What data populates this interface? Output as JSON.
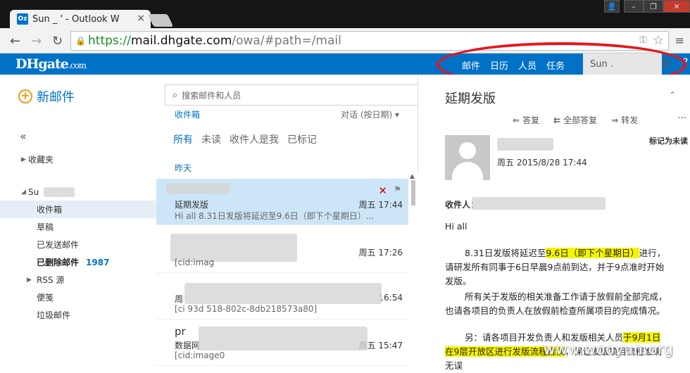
{
  "browser": {
    "tab_title": "Sun _ ' - Outlook W",
    "favicon_text": "Oz",
    "tab_close": "×",
    "url_scheme": "https://",
    "url_host": "mail.dhgate.com",
    "url_path": "/owa/#path=/mail"
  },
  "owa": {
    "logo_main": "DHgate",
    "logo_suffix": ".com",
    "nav": [
      "邮件",
      "日历",
      "人员",
      "任务"
    ],
    "user": "Sun .",
    "new_mail": "新邮件"
  },
  "folders": {
    "favorites": "收藏夹",
    "account": "Su",
    "items": [
      {
        "label": "收件箱",
        "selected": true
      },
      {
        "label": "草稿"
      },
      {
        "label": "已发送邮件"
      },
      {
        "label": "已删除邮件",
        "count": "1987",
        "bold": true
      },
      {
        "label": "RSS 源",
        "expandable": true
      },
      {
        "label": "便笺"
      },
      {
        "label": "垃圾邮件"
      }
    ]
  },
  "list": {
    "search_placeholder": "搜索邮件和人员",
    "inbox": "收件箱",
    "sort": "对话 (按日期)",
    "filters": [
      "所有",
      "未读",
      "收件人是我",
      "已标记"
    ],
    "group": "昨天",
    "messages": [
      {
        "sender": "",
        "subject": "延期发版",
        "preview": "Hi all   8.31日发版将延迟至9.6日（即下个星期日）...",
        "date": "周五 17:44"
      },
      {
        "sender": "",
        "subject": "",
        "preview": "[cid:imag",
        "date": "周五 17:26"
      },
      {
        "sender": "",
        "subject": "周",
        "preview": "[ci    93d              518-802c-8db218573a80]",
        "date": "16:54"
      },
      {
        "sender": "pr",
        "subject": "数据网",
        "preview": "[cid:image0",
        "date": "周五 15:47"
      }
    ]
  },
  "reading": {
    "subject": "延期发版",
    "actions": {
      "reply": "答复",
      "reply_all": "全部答复",
      "forward": "转发"
    },
    "date": "周五 2015/8/28 17:44",
    "mark_unread": "标记为未读",
    "to_label": "收件人：",
    "greeting": "Hi all",
    "p1_pre": "8.31日发版将延迟至",
    "p1_hl": "9.6日（即下个星期日）",
    "p1_post": "进行，",
    "p1_l2": "请研发所有同事于6日早晨9点前到达，并于9点准时开始",
    "p1_l3": "发版。",
    "p2_l1": "所有关于发版的相关准备工作请于放假前全部完成，",
    "p2_l2": "也请各项目的负责人在放假前检查所属项目的完成情况。",
    "p3_pre": "另：请各项目开发负责人和发版相关人员",
    "p3_hl": "于9月1日",
    "p3_l2_hl": "在9层开放区进行发版流程推演",
    "p3_l2_post": "，保证发版项目流程准确",
    "p3_l3": "无误"
  },
  "watermark": "www.wooyun.org"
}
